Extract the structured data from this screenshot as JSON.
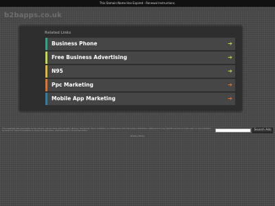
{
  "topbar": {
    "notice_text": "This Domain Name Has Expired - Renewal Instructions."
  },
  "site": {
    "domain": "b2bapps.co.uk"
  },
  "related": {
    "title": "Related Links",
    "links": [
      {
        "label": "Business Phone",
        "accent_color": "#2fa58f",
        "arrow_color": "#c9d645"
      },
      {
        "label": "Free Business Advertising",
        "accent_color": "#c7d74a",
        "arrow_color": "#c9d645"
      },
      {
        "label": "N95",
        "accent_color": "#e0b938",
        "arrow_color": "#c9d645"
      },
      {
        "label": "Ppc Marketing",
        "accent_color": "#e4742c",
        "arrow_color": "#e4742c"
      },
      {
        "label": "Mobile App Marketing",
        "accent_color": "#2f7fa8",
        "arrow_color": "#e4742c"
      }
    ],
    "arrow_glyph": "➔"
  },
  "footer": {
    "disclaimer": "This webpage was generated by the domain owner using Sedo Domain Parking. Disclaimer: Sedo maintains no relationship with third party advertisers. Reference to any specific service or trade mark is not controlled by Sedo nor does it constitute or imply its association, endorsement or recommendation.",
    "search_placeholder": "",
    "search_button": "Search Ads",
    "privacy_link": "Privacy Policy"
  }
}
